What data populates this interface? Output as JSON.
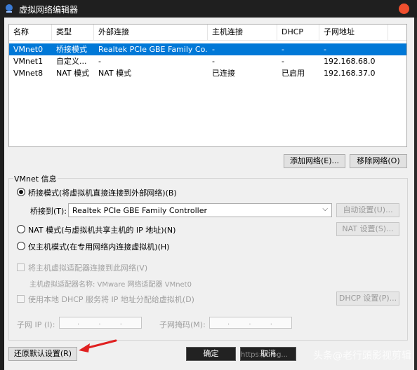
{
  "window": {
    "title": "虚拟网络编辑器"
  },
  "columns": [
    "名称",
    "类型",
    "外部连接",
    "主机连接",
    "DHCP",
    "子网地址"
  ],
  "rows": [
    [
      "VMnet0",
      "桥接模式",
      "Realtek PCIe GBE Family Co...",
      "-",
      "-",
      "-"
    ],
    [
      "VMnet1",
      "自定义...",
      "-",
      "-",
      "-",
      "192.168.68.0"
    ],
    [
      "VMnet8",
      "NAT 模式",
      "NAT 模式",
      "已连接",
      "已启用",
      "192.168.37.0"
    ]
  ],
  "buttons": {
    "add_network": "添加网络(E)...",
    "remove_network": "移除网络(O)",
    "auto_settings": "自动设置(U)...",
    "nat_settings": "NAT 设置(S)...",
    "dhcp_settings": "DHCP 设置(P)...",
    "restore_defaults": "还原默认设置(R)",
    "ok": "确定",
    "cancel": "取消"
  },
  "vmnet_info": {
    "group_label": "VMnet 信息",
    "bridged_radio": "桥接模式(将虚拟机直接连接到外部网络)(B)",
    "bridged_to_label": "桥接到(T):",
    "bridged_to_value": "Realtek PCIe GBE Family Controller",
    "nat_radio": "NAT 模式(与虚拟机共享主机的 IP 地址)(N)",
    "host_only_radio": "仅主机模式(在专用网络内连接虚拟机)(H)",
    "connect_adapter": "将主机虚拟适配器连接到此网络(V)",
    "adapter_name": "主机虚拟适配器名称: VMware 网络适配器 VMnet0",
    "use_dhcp": "使用本地 DHCP 服务将 IP 地址分配给虚拟机(D)",
    "subnet_ip_label": "子网 IP (I):",
    "subnet_mask_label": "子网掩码(M):",
    "ip_placeholder": ". . ."
  },
  "watermark": "头条@老行頭影视剪辑",
  "watermark_faint": "https://blog...",
  "colors": {
    "selection": "#0078d7",
    "close_button": "#f04f2e",
    "annotation_arrow": "#e02020"
  }
}
